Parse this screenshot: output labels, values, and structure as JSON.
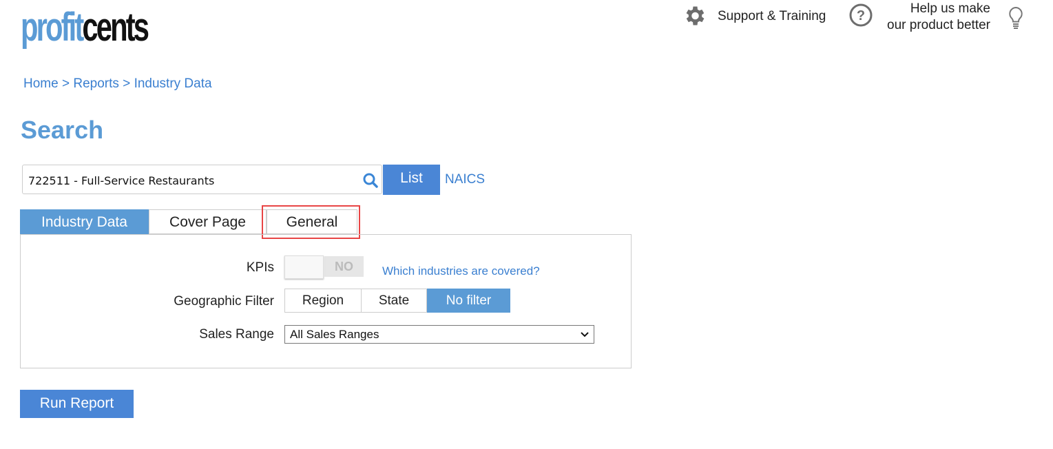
{
  "brand": {
    "logo_part1": "profit",
    "logo_part2": "cents"
  },
  "header": {
    "support": "Support & Training",
    "feedback_line1": "Help us make",
    "feedback_line2": "our product better"
  },
  "breadcrumb": {
    "items": [
      "Home",
      "Reports",
      "Industry Data"
    ],
    "sep": ">"
  },
  "page_title": "Search",
  "search": {
    "value": "722511 - Full-Service Restaurants",
    "list_label": "List",
    "naics_label": "NAICS"
  },
  "tabs": [
    {
      "label": "Industry Data",
      "active": true
    },
    {
      "label": "Cover Page"
    },
    {
      "label": "General",
      "highlighted": true
    }
  ],
  "form": {
    "kpis_label": "KPIs",
    "kpis_toggle": "NO",
    "covered_link": "Which industries are covered?",
    "geo_label": "Geographic Filter",
    "geo_options": [
      "Region",
      "State",
      "No filter"
    ],
    "geo_selected": "No filter",
    "sales_label": "Sales Range",
    "sales_value": "All Sales Ranges"
  },
  "run_label": "Run Report",
  "colors": {
    "accent": "#5b9bd5",
    "button": "#4a86d6",
    "highlight": "#e84545"
  }
}
